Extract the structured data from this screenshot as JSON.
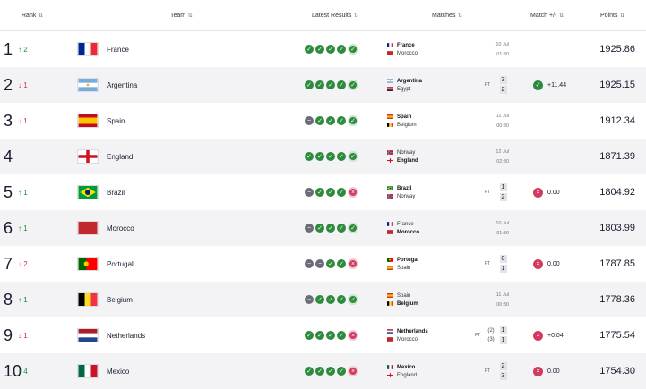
{
  "headers": {
    "rank": "Rank",
    "team": "Team",
    "latest": "Latest Results",
    "matches": "Matches",
    "mpm": "Match +/-",
    "points": "Points"
  },
  "icons": {
    "sort": "sort-icon",
    "up": "up-arrow-icon",
    "down": "down-arrow-icon",
    "win": "check-icon",
    "loss": "cross-icon",
    "draw": "minus-icon"
  },
  "colors": {
    "win": "#2e8b3e",
    "draw": "#6c6c78",
    "loss": "#d23a5e"
  },
  "rows": [
    {
      "rank": "1",
      "dir": "up",
      "change": "2",
      "team": "France",
      "flag": [
        "#002395",
        "#ffffff",
        "#ed2939"
      ],
      "results": [
        "w",
        "w",
        "w",
        "w",
        "w"
      ],
      "match": {
        "home": "France",
        "away": "Morocco",
        "bold": "home",
        "date": "10 Jul",
        "time": "01:30"
      },
      "points": "1925.86"
    },
    {
      "rank": "2",
      "dir": "down",
      "change": "1",
      "team": "Argentina",
      "flag": [
        "#74acdf",
        "#ffffff",
        "#74acdf"
      ],
      "results": [
        "w",
        "w",
        "w",
        "w",
        "w"
      ],
      "match": {
        "home": "Argentina",
        "away": "Egypt",
        "bold": "home",
        "ft": "FT",
        "score": [
          "3",
          "2"
        ]
      },
      "mpm": {
        "type": "w",
        "value": "+11.44"
      },
      "points": "1925.15"
    },
    {
      "rank": "3",
      "dir": "down",
      "change": "1",
      "team": "Spain",
      "flag": [
        "#c60b1e",
        "#ffc400",
        "#c60b1e"
      ],
      "results": [
        "d",
        "w",
        "w",
        "w",
        "w"
      ],
      "match": {
        "home": "Spain",
        "away": "Belgium",
        "bold": "home",
        "date": "11 Jul",
        "time": "00:30"
      },
      "points": "1912.34"
    },
    {
      "rank": "4",
      "dir": "",
      "change": "",
      "team": "England",
      "flag": [
        "england"
      ],
      "results": [
        "w",
        "w",
        "w",
        "w",
        "w"
      ],
      "match": {
        "home": "Norway",
        "away": "England",
        "bold": "away",
        "date": "12 Jul",
        "time": "02:30"
      },
      "points": "1871.39"
    },
    {
      "rank": "5",
      "dir": "up",
      "change": "1",
      "team": "Brazil",
      "flag": [
        "brazil"
      ],
      "results": [
        "d",
        "w",
        "w",
        "w",
        "l"
      ],
      "match": {
        "home": "Brazil",
        "away": "Norway",
        "bold": "home",
        "ft": "FT",
        "score": [
          "1",
          "2"
        ]
      },
      "mpm": {
        "type": "l",
        "value": "0.00"
      },
      "points": "1804.92"
    },
    {
      "rank": "6",
      "dir": "up",
      "change": "1",
      "team": "Morocco",
      "flag": [
        "#c1272d",
        "#c1272d",
        "#c1272d"
      ],
      "results": [
        "d",
        "w",
        "w",
        "w",
        "w"
      ],
      "match": {
        "home": "France",
        "away": "Morocco",
        "bold": "away",
        "date": "10 Jul",
        "time": "01:30"
      },
      "points": "1803.99"
    },
    {
      "rank": "7",
      "dir": "down",
      "change": "2",
      "team": "Portugal",
      "flag": [
        "portugal"
      ],
      "results": [
        "d",
        "d",
        "w",
        "w",
        "l"
      ],
      "match": {
        "home": "Portugal",
        "away": "Spain",
        "bold": "home",
        "ft": "FT",
        "score": [
          "0",
          "1"
        ]
      },
      "mpm": {
        "type": "l",
        "value": "0.00"
      },
      "points": "1787.85"
    },
    {
      "rank": "8",
      "dir": "up",
      "change": "1",
      "team": "Belgium",
      "flag": [
        "#000000",
        "#fdda24",
        "#ef3340"
      ],
      "results": [
        "d",
        "w",
        "w",
        "w",
        "w"
      ],
      "match": {
        "home": "Spain",
        "away": "Belgium",
        "bold": "away",
        "date": "11 Jul",
        "time": "00:30"
      },
      "points": "1778.36"
    },
    {
      "rank": "9",
      "dir": "down",
      "change": "1",
      "team": "Netherlands",
      "flag": [
        "netherlands"
      ],
      "results": [
        "w",
        "w",
        "w",
        "w",
        "l"
      ],
      "match": {
        "home": "Netherlands",
        "away": "Morocco",
        "bold": "home",
        "ft": "FT",
        "pens": [
          "(2)",
          "(3)"
        ],
        "score": [
          "1",
          "1"
        ]
      },
      "mpm": {
        "type": "l",
        "value": "+0.04"
      },
      "points": "1775.54"
    },
    {
      "rank": "10",
      "dir": "up",
      "change": "4",
      "team": "Mexico",
      "flag": [
        "#006847",
        "#ffffff",
        "#ce1126"
      ],
      "results": [
        "w",
        "w",
        "w",
        "w",
        "l"
      ],
      "match": {
        "home": "Mexico",
        "away": "England",
        "bold": "home",
        "ft": "FT",
        "score": [
          "2",
          "3"
        ]
      },
      "mpm": {
        "type": "l",
        "value": "0.00"
      },
      "points": "1754.30"
    }
  ]
}
